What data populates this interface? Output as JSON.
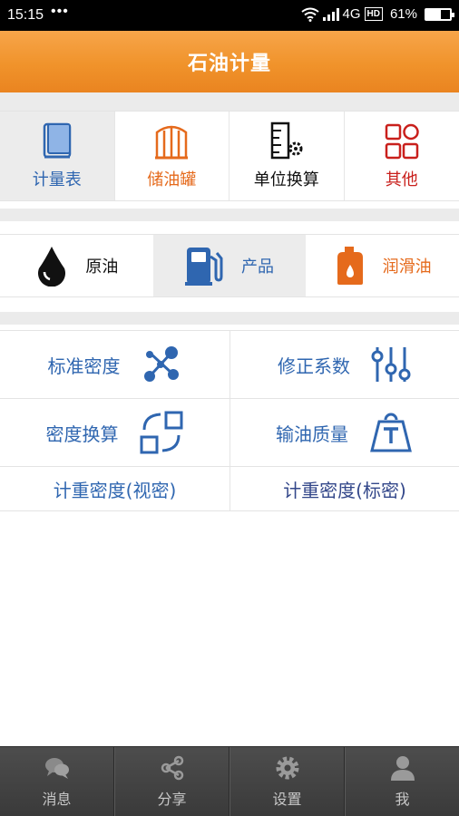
{
  "status_bar": {
    "time": "15:15",
    "dots": "•••",
    "network": "4G",
    "hd": "HD",
    "battery": "61%",
    "battery_level": 0.61
  },
  "header": {
    "title": "石油计量"
  },
  "categories": [
    {
      "label": "计量表",
      "color": "#2f66b0",
      "icon": "book-icon",
      "active": true
    },
    {
      "label": "储油罐",
      "color": "#e56a1c",
      "icon": "tank-icon",
      "active": false
    },
    {
      "label": "单位换算",
      "color": "#111111",
      "icon": "unit-conversion-icon",
      "active": false
    },
    {
      "label": "其他",
      "color": "#c9201c",
      "icon": "grid-icon",
      "active": false
    }
  ],
  "oil_types": [
    {
      "label": "原油",
      "color": "#111111",
      "icon": "oil-drop-icon",
      "active": false
    },
    {
      "label": "产品",
      "color": "#2f66b0",
      "icon": "fuel-pump-icon",
      "active": true
    },
    {
      "label": "润滑油",
      "color": "#e56a1c",
      "icon": "lubricant-can-icon",
      "active": false
    }
  ],
  "functions": {
    "standard_density": "标准密度",
    "correction_factor": "修正系数",
    "density_conversion": "密度换算",
    "oil_mass": "输油质量",
    "weight_density_apparent": "计重密度(视密)",
    "weight_density_standard": "计重密度(标密)"
  },
  "bottom_nav": [
    {
      "label": "消息",
      "icon": "message-icon"
    },
    {
      "label": "分享",
      "icon": "share-icon"
    },
    {
      "label": "设置",
      "icon": "settings-gear-icon"
    },
    {
      "label": "我",
      "icon": "user-icon"
    }
  ]
}
